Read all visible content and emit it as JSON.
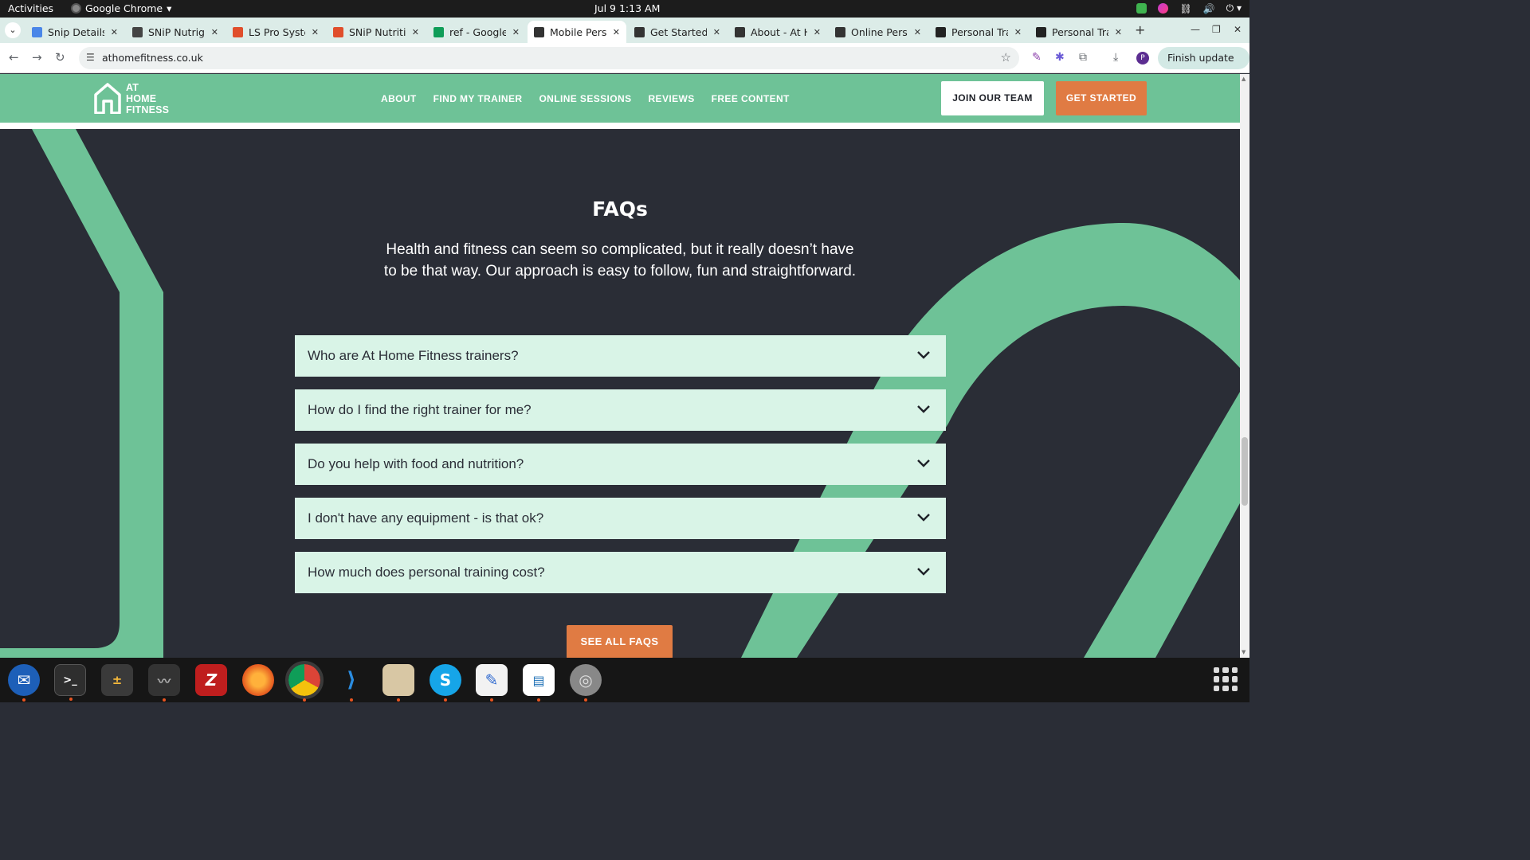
{
  "system": {
    "activities": "Activities",
    "app_name": "Google Chrome",
    "clock": "Jul 9  1:13 AM"
  },
  "browser": {
    "tabs": [
      {
        "title": "Snip Details",
        "icon": "docs-icon",
        "color": "#4a86e8"
      },
      {
        "title": "SNiP Nutrig",
        "icon": "snip-icon",
        "color": "#444444"
      },
      {
        "title": "LS Pro Syste",
        "icon": "ls-icon",
        "color": "#e04e2b"
      },
      {
        "title": "SNiP Nutriti",
        "icon": "ls-icon",
        "color": "#e04e2b"
      },
      {
        "title": "ref - Google",
        "icon": "sheets-icon",
        "color": "#0f9d58"
      },
      {
        "title": "Mobile Pers",
        "icon": "athome-icon",
        "color": "#333333"
      },
      {
        "title": "Get Started",
        "icon": "athome-icon",
        "color": "#333333"
      },
      {
        "title": "About - At H",
        "icon": "athome-icon",
        "color": "#333333"
      },
      {
        "title": "Online Pers",
        "icon": "athome-icon",
        "color": "#333333"
      },
      {
        "title": "Personal Tra",
        "icon": "fs-icon",
        "color": "#222222"
      },
      {
        "title": "Personal Tra",
        "icon": "fs-icon",
        "color": "#222222"
      }
    ],
    "active_tab": 5,
    "url": "athomefitness.co.uk",
    "finish_update": "Finish update",
    "profile_initial": "P"
  },
  "site": {
    "logo_lines": [
      "AT",
      "HOME",
      "FITNESS"
    ],
    "nav": [
      "ABOUT",
      "FIND MY TRAINER",
      "ONLINE SESSIONS",
      "REVIEWS",
      "FREE CONTENT"
    ],
    "join_button": "JOIN OUR TEAM",
    "get_started_button": "GET STARTED",
    "brand_green": "#6ec297",
    "brand_orange": "#e07b43",
    "dark_bg": "#2a2d36",
    "faq": {
      "title": "FAQs",
      "intro": "Health and fitness can seem so complicated, but it really doesn’t have to be that way. Our approach is easy to follow, fun and straightforward.",
      "questions": [
        "Who are At Home Fitness trainers?",
        "How do I find the right trainer for me?",
        "Do you help with food and nutrition?",
        "I don't have any equipment - is that ok?",
        "How much does personal training cost?"
      ],
      "see_all": "SEE ALL FAQS"
    }
  },
  "dock": [
    "thunderbird-icon",
    "terminal-icon",
    "calculator-icon",
    "system-monitor-icon",
    "filezilla-icon",
    "firefox-icon",
    "chrome-icon",
    "vscode-icon",
    "files-icon",
    "skype-icon",
    "text-editor-icon",
    "writer-icon",
    "disk-icon"
  ]
}
